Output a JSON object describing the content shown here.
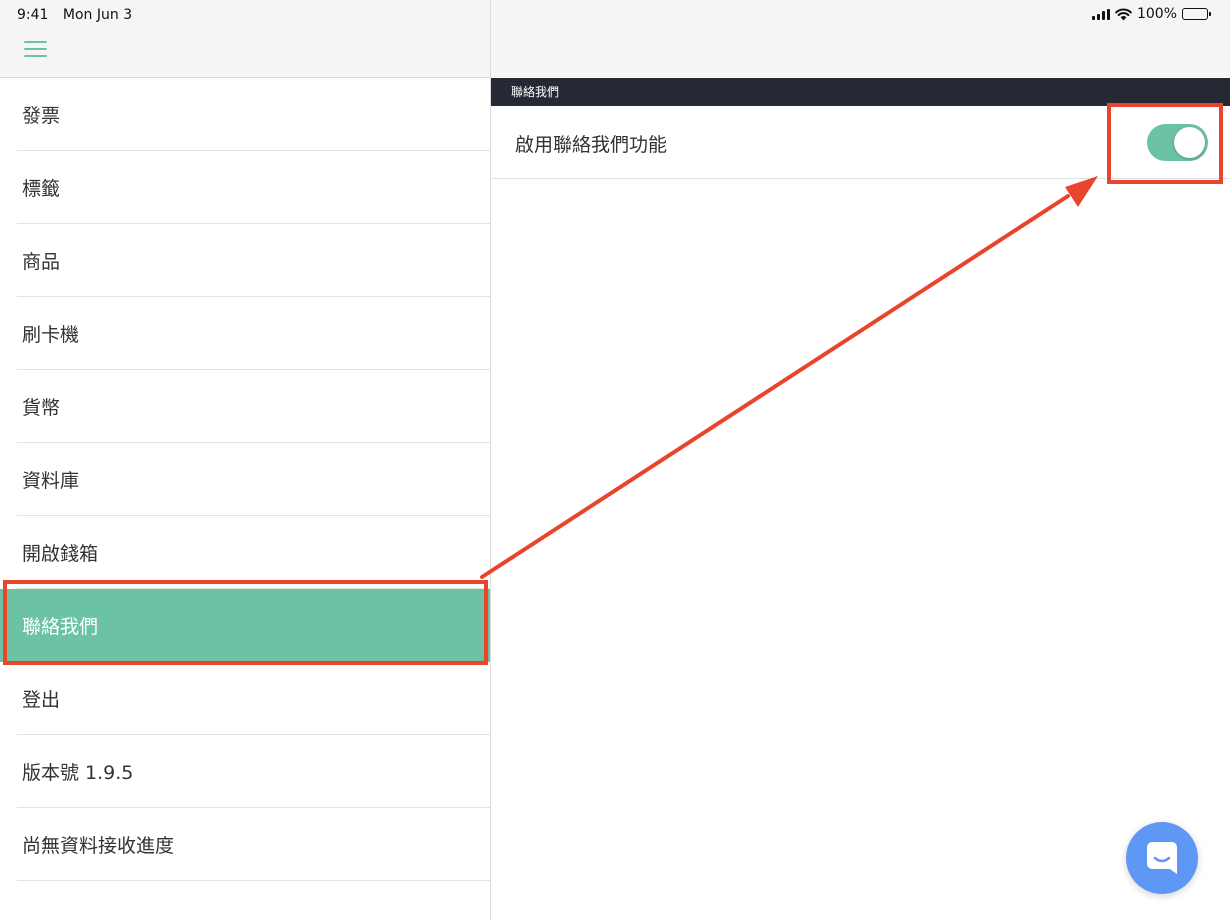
{
  "status_bar": {
    "time": "9:41",
    "date": "Mon Jun 3",
    "battery": "100%",
    "icons": [
      "signal-icon",
      "wifi-icon",
      "battery-icon"
    ]
  },
  "sidebar": {
    "menu_icon": "hamburger-icon",
    "items": [
      {
        "label": "發票"
      },
      {
        "label": "標籤"
      },
      {
        "label": "商品"
      },
      {
        "label": "刷卡機"
      },
      {
        "label": "貨幣"
      },
      {
        "label": "資料庫"
      },
      {
        "label": "開啟錢箱"
      },
      {
        "label": "聯絡我們",
        "active": true
      },
      {
        "label": "登出"
      },
      {
        "label": "版本號 1.9.5"
      },
      {
        "label": "尚無資料接收進度"
      }
    ]
  },
  "detail": {
    "section_title": "聯絡我們",
    "setting_label": "啟用聯絡我們功能",
    "toggle_on": true
  },
  "chat_button": {
    "icon": "chat-icon"
  },
  "colors": {
    "accent": "#6cc3a3",
    "section_bar": "#262834",
    "annotation": "#e8452c",
    "chat": "#5f97f5"
  }
}
